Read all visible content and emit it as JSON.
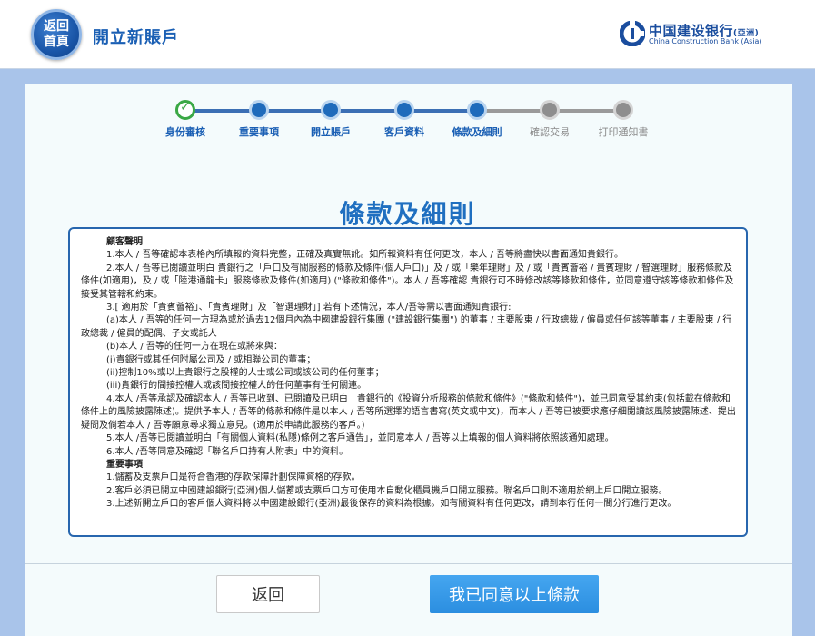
{
  "header": {
    "home_button_line1": "返回",
    "home_button_line2": "首頁",
    "title": "開立新賬戶",
    "bank_name_zh": "中国建设银行",
    "bank_name_zh_suffix": "(亞洲)",
    "bank_name_en": "China Construction Bank (Asia)"
  },
  "stepper": {
    "current_index": 4,
    "steps": [
      {
        "label": "身份審核",
        "status": "done"
      },
      {
        "label": "重要事項",
        "status": "active"
      },
      {
        "label": "開立賬戶",
        "status": "active"
      },
      {
        "label": "客戶資料",
        "status": "active"
      },
      {
        "label": "條款及細則",
        "status": "active"
      },
      {
        "label": "確認交易",
        "status": "pending"
      },
      {
        "label": "打印通知書",
        "status": "pending"
      }
    ]
  },
  "section_title": "條款及細則",
  "terms": {
    "customer_declaration_heading": "顧客聲明",
    "para1": "1.本人 / 吾等確認本表格內所填報的資料完整，正確及真實無訛。如所報資料有任何更改，本人 / 吾等將盡快以書面通知貴銀行。",
    "para2": "2.本人 / 吾等已閱讀並明白 貴銀行之「戶口及有關服務的條款及條件(個人戶口)」及 / 或「樂年理財」及 / 或「貴賓薈裕 / 貴賓理財 / 智選理財」服務條款及條件(如適用)，及 / 或「陸港通龍卡」服務條款及條件(如適用) (\"條款和條件\")。本人 / 吾等確認 貴銀行可不時修改該等條款和條件，並同意遵守該等條款和條件及接受其管轄和約束。",
    "para3": "3.[ 適用於「貴賓薈裕」、「貴賓理財」及「智選理財」] 若有下述情況，本人/吾等需以書面通知貴銀行:",
    "para3a": "(a)本人 / 吾等的任何一方現為或於過去12個月內為中國建設銀行集團 (\"建設銀行集團\") 的董事 / 主要股東 / 行政總裁 / 僱員或任何該等董事 / 主要股東 / 行政總裁 / 僱員的配偶、子女或託人",
    "para3b": "(b)本人 / 吾等的任何一方在現在或將來與：",
    "para3b_i": "(i)貴銀行或其任何附屬公司及 / 或相聯公司的董事；",
    "para3b_ii": "(ii)控制10%或以上貴銀行之股權的人士或公司或該公司的任何董事；",
    "para3b_iii": "(iii)貴銀行的間接控權人或該間接控權人的任何董事有任何關連。",
    "para4": "4.本人 /吾等承認及確認本人 / 吾等已收到、已閱讀及已明白　貴銀行的《投資分析服務的條款和條件》(\"條款和條件\")，並已同意受其約束(包括載在條款和條件上的風險披露陳述)。提供予本人 / 吾等的條款和條件是以本人 / 吾等所選擇的語言書寫(英文或中文)，而本人 / 吾等已被要求應仔細閱讀該風險披露陳述、提出疑問及倘若本人 / 吾等願意尋求獨立意見。(適用於申請此服務的客戶。)",
    "para5": "5.本人 /吾等已閱讀並明白「有關個人資料(私隱)條例之客戶通告」，並同意本人 / 吾等以上填報的個人資料將依照該通知處理。",
    "para6": "6.本人 /吾等同意及確認「聯名戶口持有人附表」中的資料。",
    "important_heading": "重要事項",
    "imp1": "1.儲蓄及支票戶口是符合香港的存款保障計劃保障資格的存款。",
    "imp2": "2.客戶必須已開立中國建設銀行(亞洲)個人儲蓄或支票戶口方可使用本自動化櫃員機戶口開立服務。聯名戶口則不適用於網上戶口開立服務。",
    "imp3": "3.上述新開立戶口的客戶個人資料將以中國建設銀行(亞洲)最後保存的資料為根據。如有關資料有任何更改，請到本行任何一間分行進行更改。"
  },
  "buttons": {
    "back": "返回",
    "agree": "我已同意以上條款"
  },
  "colors": {
    "brand_blue": "#1f6fc0",
    "frame_blue": "#a9c4ea",
    "done_green": "#3aa845",
    "pending_gray": "#8e8e8e",
    "agree_button": "#2b8ee0"
  }
}
